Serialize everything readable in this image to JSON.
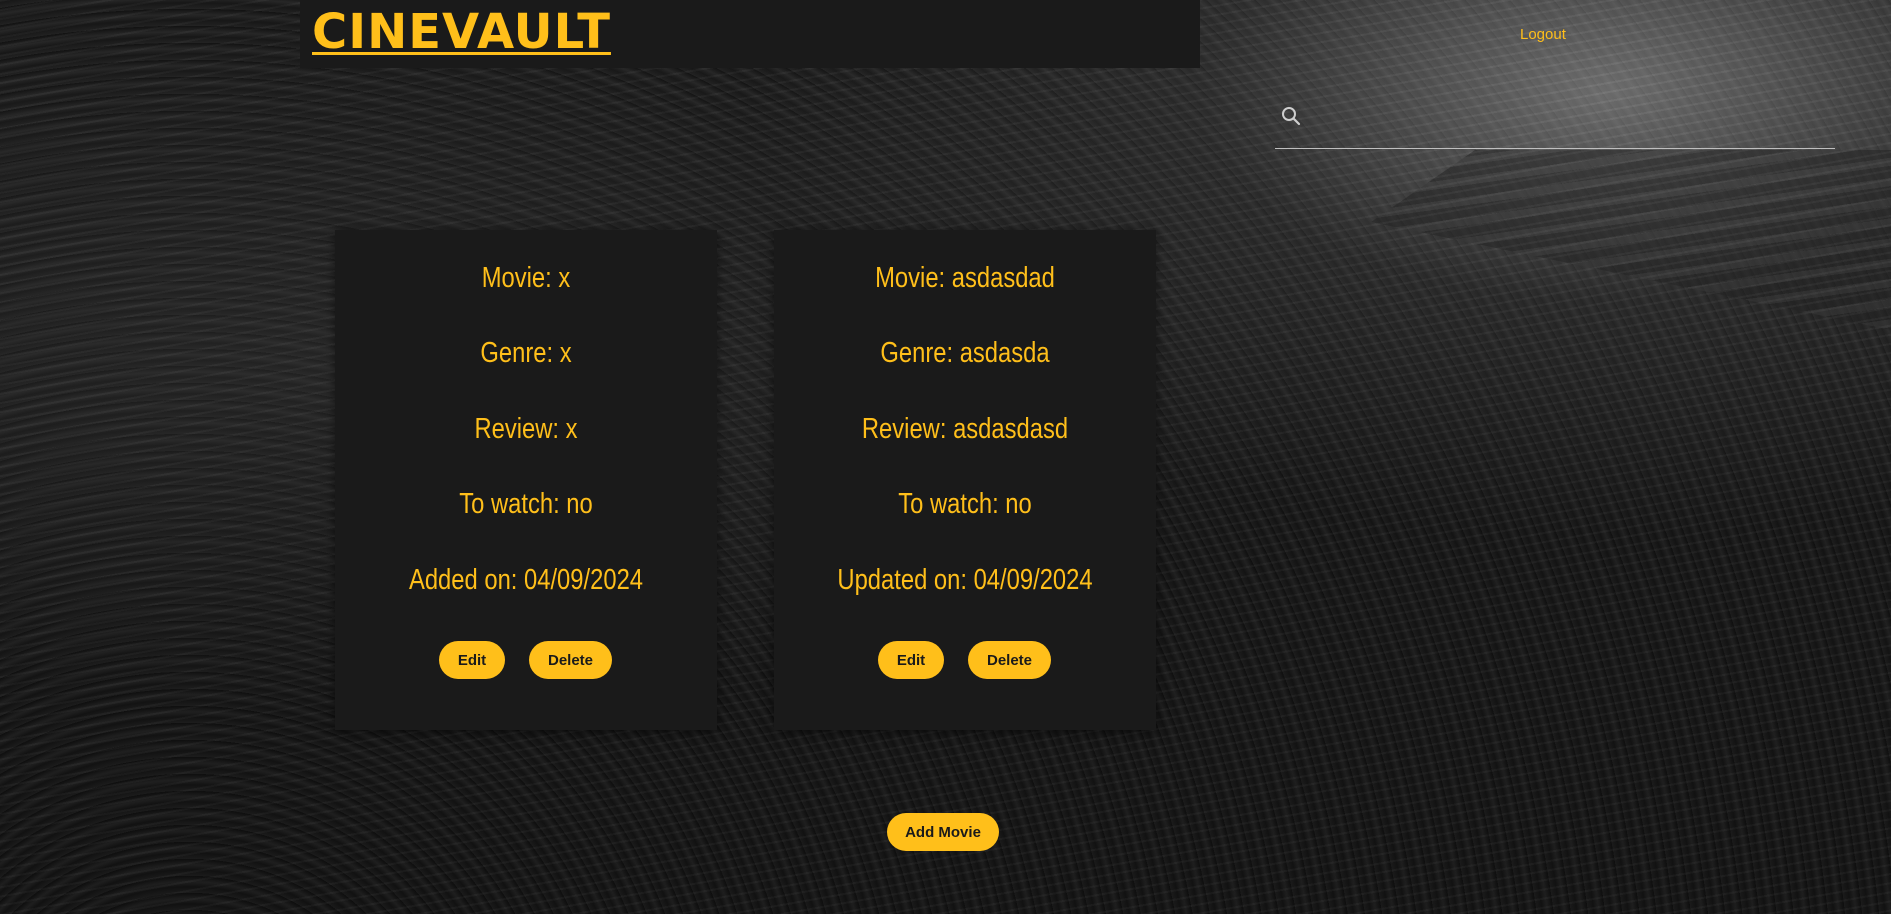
{
  "header": {
    "brand": "CINEVAULT",
    "logout_label": "Logout"
  },
  "search": {
    "placeholder": "",
    "value": "",
    "icon": "search-icon"
  },
  "movies": [
    {
      "movie": "Movie: x",
      "genre": "Genre: x",
      "review": "Review: x",
      "to_watch": "To watch: no",
      "date": "Added on: 04/09/2024",
      "edit_label": "Edit",
      "delete_label": "Delete"
    },
    {
      "movie": "Movie: asdasdad",
      "genre": "Genre: asdasda",
      "review": "Review: asdasdasd",
      "to_watch": "To watch: no",
      "date": "Updated on: 04/09/2024",
      "edit_label": "Edit",
      "delete_label": "Delete"
    }
  ],
  "actions": {
    "add_movie_label": "Add Movie"
  },
  "colors": {
    "accent": "#ffbf1a",
    "card_bg": "#1a1a1a",
    "text_dark": "#1a1a1a"
  }
}
